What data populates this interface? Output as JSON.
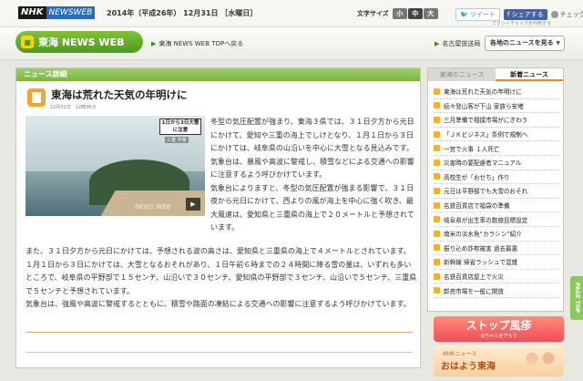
{
  "top": {
    "logo_nhk": "NHK",
    "logo_news": "NEWSWEB",
    "date": "2014年（平成26年） 12月31日 ［水曜日］",
    "font_size_label": "文字サイズ",
    "font_sizes": [
      "小",
      "中",
      "大"
    ],
    "tweet": "ツイート",
    "share": "シェアする",
    "check": "チェック",
    "mixi_note": "ミクシィチェックを利用する"
  },
  "header": {
    "brand": "東海 NEWS WEB",
    "top_link": "東海 NEWS WEB TOPへ戻る",
    "station_link": "名古屋放送局",
    "region_select": "各地のニュースを見る"
  },
  "article": {
    "section_label": "ニュース詳細",
    "headline": "東海は荒れた天気の年明けに",
    "timestamp": "12月31日　12時36分",
    "video_caption": "1日から3日大雪に注意",
    "video_sub": "三重 中南",
    "video_watermark": "NEWS WEB",
    "para1": "冬型の気圧配置が強まり、東海３県では、３１日夕方から元日にかけて、愛知や三重の海上でしけとなり、１月１日から３日にかけては、岐阜県の山沿いを中心に大雪となる見込みです。",
    "para2": "気象台は、暴風や高波に警戒し、積雪などによる交通への影響に注意するよう呼びかけています。",
    "para3a": "気象台によりますと、冬型の気圧配置が強まる影響で、３１日夜から元日にかけて、西よりの風が海上を中心に強く吹き、最大風速は、愛知県と三重県の海上で２０メートルと予想されています。",
    "para3b": "また、３１日夕方から元日にかけては、予想される波の高さは、愛知県と三重県の海上で４メートルとされています。",
    "para4": "１月１日から３日にかけては、大雪となるおそれがあり、１日午前６時までの２４時間に降る雪の量は、いずれも多いところで、岐阜県の平野部で１５センチ、山沿いで３０センチ、愛知県の平野部で３センチ、山沿いで５センチ、三重県で５センチと予想されています。",
    "para5": "気象台は、強風や高波に警戒するとともに、積雪や路面の凍結による交通への影響に注意するよう呼びかけています。"
  },
  "sidebar": {
    "tab_tokai": "東海のニュース",
    "tab_latest": "新着ニュース",
    "items": [
      "東海は荒れた天気の年明けに",
      "続々登山客が下山 家族ら安堵",
      "三月準備で相撲市場がにぎわう",
      "「ＪＫビジネス」条例で規制へ",
      "一宮で火事 １人死亡",
      "災害時の要配慮者マニュアル",
      "高校生が「おせち」作り",
      "元日は平野部でも大雪のおそれ",
      "名鉄百貨店で福袋の準備",
      "岐阜県が出生率の数値目標設定",
      "南米の淡水魚“カラシン”紹介",
      "振り込め詐欺被害 過去最悪",
      "新幹線 帰省ラッシュで混雑",
      "名鉄百貨店屋上で火災",
      "卸売市場を一般に開放"
    ]
  },
  "banners": {
    "stop_title": "ストップ風疹",
    "stop_sub": "赤ちゃんを守ろう",
    "ohayo_brand": "NHKニュース",
    "ohayo_title": "おはよう東海"
  },
  "page_top": "PAGE TOP"
}
